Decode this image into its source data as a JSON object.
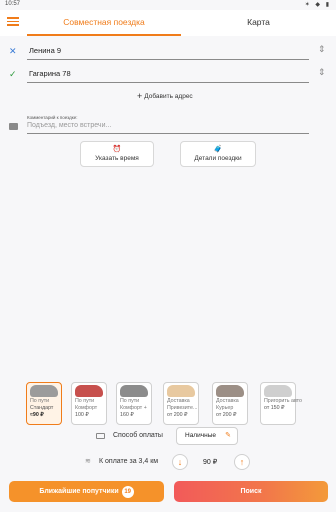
{
  "status_bar": {
    "time": "10:57",
    "icons_text": "✶ ◆ ▮"
  },
  "tabs": {
    "joint": "Совместная поездка",
    "map": "Карта"
  },
  "addresses": [
    {
      "value": "Ленина 9",
      "marker": "✕"
    },
    {
      "value": "Гагарина 78",
      "marker": "✓"
    }
  ],
  "add_address": {
    "plus": "+",
    "label": "Добавить адрес"
  },
  "comment": {
    "label": "Комментарий к поездке:",
    "placeholder": "Подъезд, место встречи..."
  },
  "buttons": {
    "time": {
      "icon": "⏰",
      "label": "Указать время"
    },
    "details": {
      "icon": "🧳",
      "label": "Детали поездки"
    }
  },
  "tariffs": [
    {
      "line1": "По пути",
      "line2": "Стандарт",
      "price": "≈90 ₽",
      "color": "#9b9b9b",
      "selected": true
    },
    {
      "line1": "По пути",
      "line2": "Комфорт",
      "price": "100 ₽",
      "color": "#c7504d",
      "selected": false
    },
    {
      "line1": "По пути",
      "line2": "Комфорт +",
      "price": "160 ₽",
      "color": "#8c8c8c",
      "selected": false
    },
    {
      "line1": "Доставка",
      "line2": "Привезите...",
      "price": "от 200 ₽",
      "color": "#e8c9a0",
      "selected": false
    },
    {
      "line1": "Доставка",
      "line2": "Курьер",
      "price": "от 200 ₽",
      "color": "#9c8f86",
      "selected": false
    },
    {
      "line1": "",
      "line2": "Пригорить авто",
      "price": "от 150 ₽",
      "color": "#cfcfcf",
      "selected": false
    }
  ],
  "payment": {
    "label": "Способ оплаты",
    "value": "Наличные",
    "edit_icon": "✎"
  },
  "price": {
    "label": "К оплате за 3,4 км",
    "amount": "90 ₽",
    "minus": "↓",
    "plus": "↑"
  },
  "bottom": {
    "nearby_label": "Ближайшие попутчики",
    "nearby_count": "19",
    "search_label": "Поиск"
  },
  "colors": {
    "accent": "#f07c1a"
  }
}
